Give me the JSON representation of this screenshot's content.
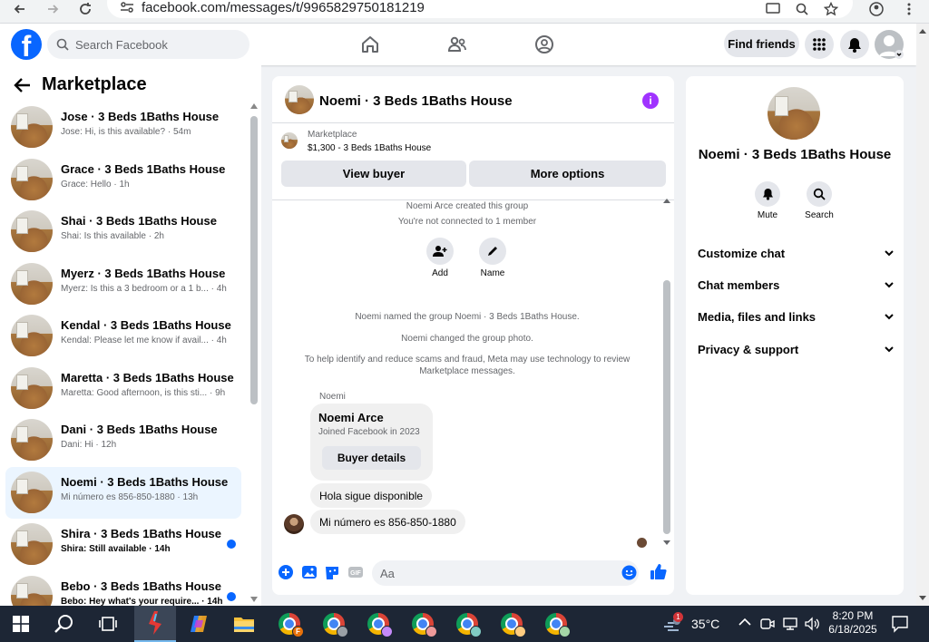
{
  "browser": {
    "url": "facebook.com/messages/t/9965829750181219"
  },
  "header": {
    "logo_letter": "f",
    "search_placeholder": "Search Facebook",
    "find_friends": "Find friends",
    "brand_color": "#0866ff"
  },
  "sidebar": {
    "title": "Marketplace",
    "conversations": [
      {
        "name": "Jose · 3 Beds 1Baths House",
        "preview": "Jose: Hi, is this available? · 54m",
        "unread": false,
        "active": false
      },
      {
        "name": "Grace · 3 Beds 1Baths House",
        "preview": "Grace: Hello · 1h",
        "unread": false,
        "active": false
      },
      {
        "name": "Shai · 3 Beds 1Baths House",
        "preview": "Shai: Is this available · 2h",
        "unread": false,
        "active": false
      },
      {
        "name": "Myerz · 3 Beds 1Baths House",
        "preview": "Myerz: Is this a 3 bedroom or a 1 b... · 4h",
        "unread": false,
        "active": false
      },
      {
        "name": "Kendal · 3 Beds 1Baths House",
        "preview": "Kendal: Please let me know if avail... · 4h",
        "unread": false,
        "active": false
      },
      {
        "name": "Maretta · 3 Beds 1Baths House",
        "preview": "Maretta: Good afternoon, is this sti... · 9h",
        "unread": false,
        "active": false
      },
      {
        "name": "Dani · 3 Beds 1Baths House",
        "preview": "Dani: Hi · 12h",
        "unread": false,
        "active": false
      },
      {
        "name": "Noemi · 3 Beds 1Baths House",
        "preview": "Mi número es 856-850-1880 · 13h",
        "unread": false,
        "active": true
      },
      {
        "name": "Shira · 3 Beds 1Baths House",
        "preview": "Shira: Still available · 14h",
        "unread": true,
        "active": false
      },
      {
        "name": "Bebo · 3 Beds 1Baths House",
        "preview": "Bebo: Hey what's your require... · 14h",
        "unread": true,
        "active": false
      }
    ]
  },
  "chat": {
    "title": "Noemi · 3 Beds 1Baths House",
    "marketplace_label": "Marketplace",
    "listing": "$1,300 - 3 Beds 1Baths House",
    "view_buyer": "View buyer",
    "more_options": "More options",
    "created": "Noemi Arce created this group",
    "not_connected": "You're not connected to 1 member",
    "add_label": "Add",
    "name_label": "Name",
    "named_group": "Noemi named the group Noemi · 3 Beds 1Baths House.",
    "changed_photo": "Noemi changed the group photo.",
    "scam_notice": "To help identify and reduce scams and fraud, Meta may use technology to review Marketplace messages.",
    "sender": "Noemi",
    "card_name": "Noemi Arce",
    "card_sub": "Joined Facebook in 2023",
    "buyer_details": "Buyer details",
    "msg1": "Hola sigue disponible",
    "msg2": "Mi número es 856-850-1880",
    "composer_placeholder": "Aa",
    "gif_label": "GIF"
  },
  "details": {
    "name": "Noemi · 3 Beds 1Baths House",
    "mute": "Mute",
    "search": "Search",
    "sections": [
      "Customize chat",
      "Chat members",
      "Media, files and links",
      "Privacy & support"
    ]
  },
  "taskbar": {
    "temperature": "35°C",
    "time": "8:20 PM",
    "date": "6/18/2025",
    "weather_badge": "1",
    "profile_letter": "F"
  }
}
